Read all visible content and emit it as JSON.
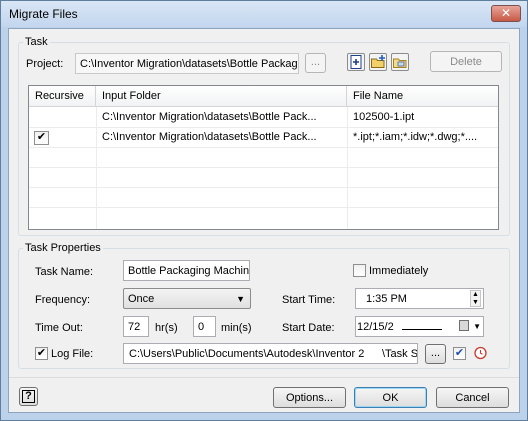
{
  "window": {
    "title": "Migrate Files",
    "close_glyph": "✕"
  },
  "task": {
    "group_label": "Task",
    "project_label": "Project:",
    "project_value": "C:\\Inventor Migration\\datasets\\Bottle Packag",
    "browse_label": "...",
    "delete_label": "Delete",
    "icons": [
      "add-file-icon",
      "add-folder-icon",
      "add-project-icon"
    ]
  },
  "table": {
    "headers": {
      "recursive": "Recursive",
      "input_folder": "Input Folder",
      "file_name": "File Name"
    },
    "rows": [
      {
        "recursive": false,
        "folder": "C:\\Inventor Migration\\datasets\\Bottle Pack...",
        "file": "102500-1.ipt"
      },
      {
        "recursive": true,
        "folder": "C:\\Inventor Migration\\datasets\\Bottle Pack...",
        "file": "*.ipt;*.iam;*.idw;*.dwg;*...."
      }
    ],
    "check_glyph": "✔"
  },
  "props": {
    "group_label": "Task Properties",
    "task_name_label": "Task Name:",
    "task_name_value": "Bottle Packaging Machine",
    "immediately_label": "Immediately",
    "frequency_label": "Frequency:",
    "frequency_value": "Once",
    "start_time_label": "Start Time:",
    "start_time_value": "1:35 PM",
    "timeout_label": "Time Out:",
    "timeout_hours": "72",
    "hours_unit": "hr(s)",
    "timeout_minutes": "0",
    "minutes_unit": "min(s)",
    "start_date_label": "Start Date:",
    "start_date_value": "12/15/2",
    "log_file_label": "Log File:",
    "log_file_path": "C:\\Users\\Public\\Documents\\Autodesk\\Inventor 2",
    "log_file_name": "\\Task S",
    "log_browse_label": "..."
  },
  "footer": {
    "help_label": "?",
    "options_label": "Options...",
    "ok_label": "OK",
    "cancel_label": "Cancel"
  }
}
